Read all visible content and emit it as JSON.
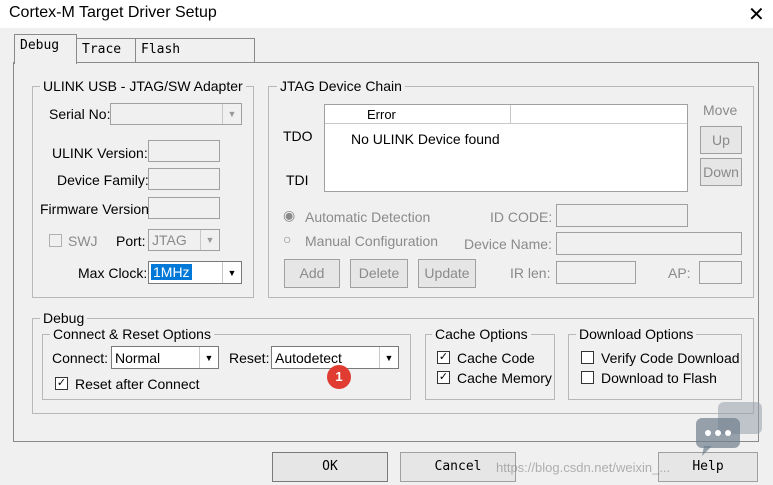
{
  "window": {
    "title": "Cortex-M Target Driver Setup",
    "close_glyph": "✕"
  },
  "tabs": [
    {
      "label": "Debug"
    },
    {
      "label": "Trace"
    },
    {
      "label": "Flash Download"
    }
  ],
  "ulink": {
    "legend": "ULINK USB - JTAG/SW Adapter",
    "serial_label": "Serial No:",
    "version_label": "ULINK Version:",
    "family_label": "Device Family:",
    "firmware_label": "Firmware Version:",
    "swj_label": "SWJ",
    "port_label": "Port:",
    "port_value": "JTAG",
    "maxclock_label": "Max Clock:",
    "maxclock_value": "1MHz"
  },
  "jtag": {
    "legend": "JTAG Device Chain",
    "tdo": "TDO",
    "tdi": "TDI",
    "col_error": "Error",
    "message": "No ULINK Device found",
    "move_label": "Move",
    "up": "Up",
    "down": "Down",
    "auto_detect": "Automatic Detection",
    "manual_config": "Manual Configuration",
    "idcode_label": "ID CODE:",
    "devname_label": "Device Name:",
    "add": "Add",
    "delete": "Delete",
    "update": "Update",
    "irlen_label": "IR len:",
    "ap_label": "AP:"
  },
  "debug": {
    "legend": "Debug",
    "connect_reset_legend": "Connect & Reset Options",
    "connect_label": "Connect:",
    "connect_value": "Normal",
    "reset_label": "Reset:",
    "reset_value": "Autodetect",
    "badge": "1",
    "reset_after_connect": "Reset after Connect",
    "cache_legend": "Cache Options",
    "cache_code": "Cache Code",
    "cache_memory": "Cache Memory",
    "download_legend": "Download Options",
    "verify_code": "Verify Code Download",
    "download_flash": "Download to Flash"
  },
  "buttons": {
    "ok": "OK",
    "cancel": "Cancel",
    "help": "Help"
  },
  "watermark": "https://blog.csdn.net/weixin_...",
  "colors": {
    "badge": "#e03c31",
    "selection": "#0078d7"
  }
}
